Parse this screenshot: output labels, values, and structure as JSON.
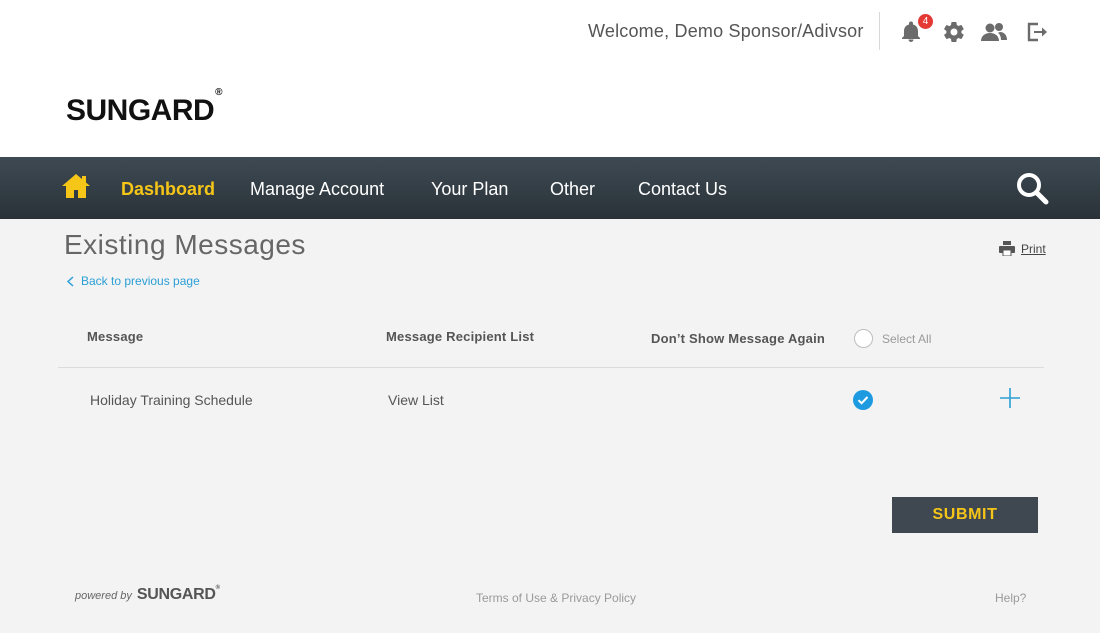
{
  "header": {
    "welcome": "Welcome, Demo Sponsor/Adivsor",
    "notification_count": "4",
    "icons": [
      "bell-icon",
      "gear-icon",
      "users-icon",
      "logout-icon"
    ]
  },
  "brand": {
    "logo_text": "SUNGARD",
    "registered_mark": "®"
  },
  "nav": {
    "items": [
      {
        "label": "Dashboard",
        "active": true
      },
      {
        "label": "Manage Account",
        "active": false
      },
      {
        "label": "Your Plan",
        "active": false
      },
      {
        "label": "Other",
        "active": false
      },
      {
        "label": "Contact Us",
        "active": false
      }
    ],
    "icons": [
      "home-icon",
      "search-icon"
    ]
  },
  "page": {
    "title": "Existing Messages",
    "print_label": "Print",
    "back_label": "Back to previous page"
  },
  "table": {
    "columns": [
      "Message",
      "Message Recipient List",
      "Don’t Show Message Again"
    ],
    "select_all_label": "Select All",
    "select_all_checked": false,
    "rows": [
      {
        "message": "Holiday Training Schedule",
        "recipients": "View List",
        "dont_show_again": true
      }
    ]
  },
  "actions": {
    "submit_label": "SUBMIT"
  },
  "footer": {
    "powered_by": "powered by",
    "logo_text": "SUNGARD",
    "registered_mark": "®",
    "terms": "Terms of Use & Privacy Policy",
    "help": "Help?"
  },
  "colors": {
    "accent_yellow": "#f5c518",
    "nav_bg": "#3e4a53",
    "link_blue": "#2a9fd6",
    "badge_red": "#e53935"
  }
}
